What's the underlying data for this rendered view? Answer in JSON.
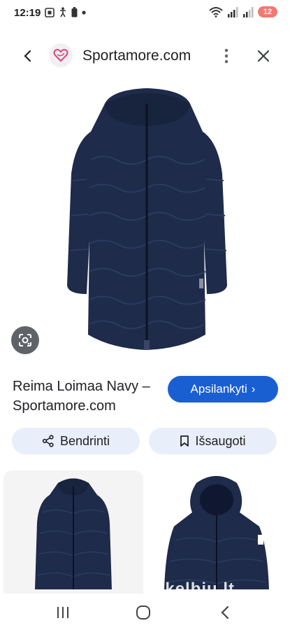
{
  "status_bar": {
    "time": "12:19",
    "battery": "12"
  },
  "topbar": {
    "site_name": "Sportamore.com"
  },
  "result": {
    "title": "Reima Loimaa Navy – Sportamore.com",
    "visit_label": "Apsilankyti",
    "visit_chevron": "›",
    "share_label": "Bendrinti",
    "save_label": "Išsaugoti"
  },
  "related": {
    "watermark": "skelbiu.lt"
  },
  "icons": {
    "back": "chevron-left",
    "more": "vertical-dots",
    "close": "x",
    "lens": "google-lens",
    "share": "share-nodes",
    "save": "bookmark"
  },
  "colors": {
    "accent": "#1a5fd2",
    "chip_bg": "#e8eefa",
    "jacket": "#1e2b4a",
    "battery": "#f07a6f"
  }
}
